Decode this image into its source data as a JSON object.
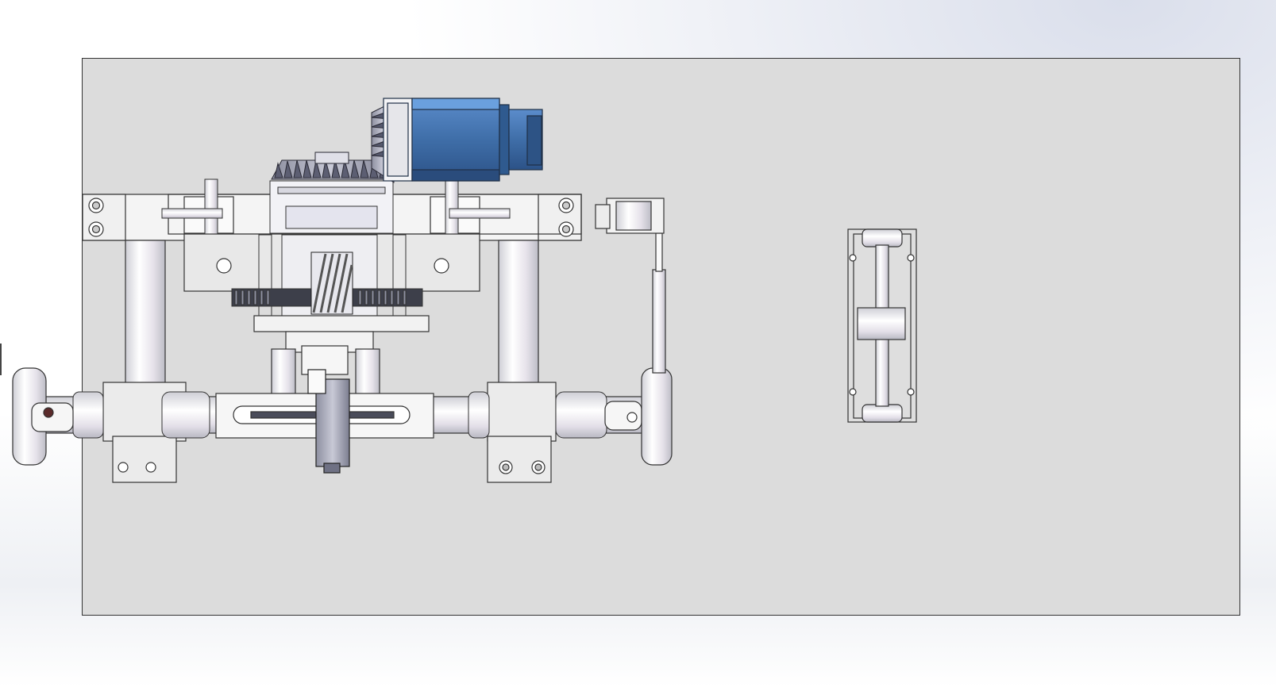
{
  "scene": {
    "background": "#ffffff",
    "plate_color": "#dcdcdc",
    "motor_color": "#4a78b0",
    "motor_dark": "#2f5a8f",
    "part_fill": "#f2f2f2",
    "edge_color": "#333333"
  }
}
